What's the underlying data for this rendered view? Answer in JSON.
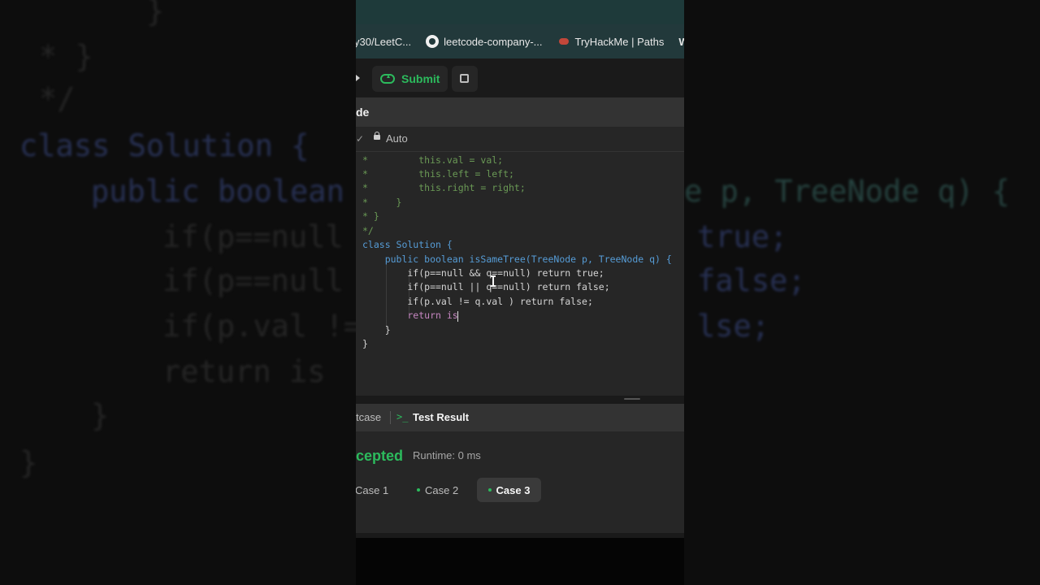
{
  "backdrop": {
    "lines": [
      "}",
      "* }",
      "*/",
      "class Solution {",
      "public boolean",
      "if(p==null",
      "if(p==null",
      "if(p.val !=",
      "return is",
      "}",
      "}",
      "e p, TreeNode q) {",
      "true;",
      "false;",
      "lse;"
    ]
  },
  "bookmarks": [
    {
      "label": "y30/LeetC..."
    },
    {
      "label": "leetcode-company-..."
    },
    {
      "label": "TryHackMe | Paths"
    },
    {
      "label": "W"
    }
  ],
  "toolbar": {
    "submit_label": "Submit"
  },
  "editor": {
    "title": "de",
    "language_mode": "Auto",
    "chevron": "✓",
    "code_lines": [
      "*         this.val = val;",
      "*         this.left = left;",
      "*         this.right = right;",
      "*     }",
      "* }",
      "*/",
      "class Solution {",
      "    public boolean isSameTree(TreeNode p, TreeNode q) {",
      "        if(p==null && q==null) return true;",
      "        if(p==null || q==null) return false;",
      "        if(p.val != q.val ) return false;",
      "        return is",
      "    }",
      "}"
    ]
  },
  "results": {
    "tab_testcase": "tcase",
    "tab_result": "Test Result",
    "status": "cepted",
    "runtime": "Runtime: 0 ms",
    "cases": [
      "Case 1",
      "Case 2",
      "Case 3"
    ]
  },
  "colors": {
    "accent_green": "#2cbb5d",
    "bookmark_bar": "#22393b",
    "editor_bg": "#262626"
  }
}
